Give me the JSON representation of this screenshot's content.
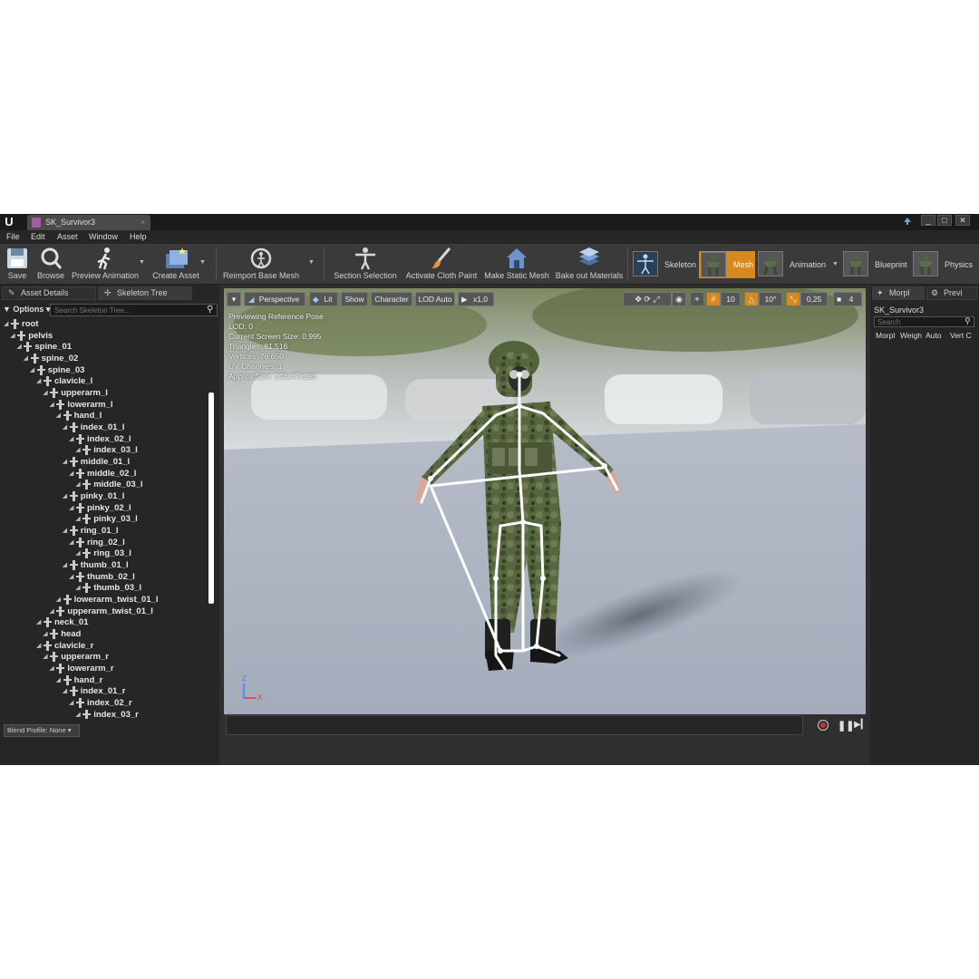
{
  "window": {
    "tab_title": "SK_Survivor3",
    "tab_close": "×",
    "logo": "U",
    "controls": [
      "_",
      "□",
      "✕"
    ]
  },
  "menu": [
    "File",
    "Edit",
    "Asset",
    "Window",
    "Help"
  ],
  "toolbar": {
    "save": "Save",
    "browse": "Browse",
    "preview_animation": "Preview Animation",
    "create_asset": "Create Asset",
    "reimport_base_mesh": "Reimport Base Mesh",
    "section_selection": "Section Selection",
    "activate_cloth_paint": "Activate Cloth Paint",
    "make_static_mesh": "Make Static Mesh",
    "bake_out_materials": "Bake out Materials",
    "modes": [
      "Skeleton",
      "Mesh",
      "Animation",
      "Blueprint",
      "Physics"
    ],
    "active_mode": "Mesh"
  },
  "left_panel": {
    "tabs": [
      "Asset Details",
      "Skeleton Tree"
    ],
    "options_label": "Options",
    "search_placeholder": "Search Skeleton Tree...",
    "blend_profile": "Blend Profile: None",
    "bones": [
      {
        "name": "root",
        "depth": 0
      },
      {
        "name": "pelvis",
        "depth": 1
      },
      {
        "name": "spine_01",
        "depth": 2
      },
      {
        "name": "spine_02",
        "depth": 3
      },
      {
        "name": "spine_03",
        "depth": 4
      },
      {
        "name": "clavicle_l",
        "depth": 5
      },
      {
        "name": "upperarm_l",
        "depth": 6
      },
      {
        "name": "lowerarm_l",
        "depth": 7
      },
      {
        "name": "hand_l",
        "depth": 8
      },
      {
        "name": "index_01_l",
        "depth": 9
      },
      {
        "name": "index_02_l",
        "depth": 10
      },
      {
        "name": "index_03_l",
        "depth": 11
      },
      {
        "name": "middle_01_l",
        "depth": 9
      },
      {
        "name": "middle_02_l",
        "depth": 10
      },
      {
        "name": "middle_03_l",
        "depth": 11
      },
      {
        "name": "pinky_01_l",
        "depth": 9
      },
      {
        "name": "pinky_02_l",
        "depth": 10
      },
      {
        "name": "pinky_03_l",
        "depth": 11
      },
      {
        "name": "ring_01_l",
        "depth": 9
      },
      {
        "name": "ring_02_l",
        "depth": 10
      },
      {
        "name": "ring_03_l",
        "depth": 11
      },
      {
        "name": "thumb_01_l",
        "depth": 9
      },
      {
        "name": "thumb_02_l",
        "depth": 10
      },
      {
        "name": "thumb_03_l",
        "depth": 11
      },
      {
        "name": "lowerarm_twist_01_l",
        "depth": 8
      },
      {
        "name": "upperarm_twist_01_l",
        "depth": 7
      },
      {
        "name": "neck_01",
        "depth": 5
      },
      {
        "name": "head",
        "depth": 6
      },
      {
        "name": "clavicle_r",
        "depth": 5
      },
      {
        "name": "upperarm_r",
        "depth": 6
      },
      {
        "name": "lowerarm_r",
        "depth": 7
      },
      {
        "name": "hand_r",
        "depth": 8
      },
      {
        "name": "index_01_r",
        "depth": 9
      },
      {
        "name": "index_02_r",
        "depth": 10
      },
      {
        "name": "index_03_r",
        "depth": 11
      }
    ]
  },
  "viewport": {
    "perspective": "Perspective",
    "lit": "Lit",
    "show": "Show",
    "character": "Character",
    "lod": "LOD Auto",
    "play_speed": "x1,0",
    "grid_snap": "10",
    "rot_snap": "10°",
    "scale_snap": "0,25",
    "camera_speed": "4",
    "info": [
      "Previewing Reference Pose",
      "LOD: 0",
      "Current Screen Size: 0,995",
      "Triangles: 81 516",
      "Vertices: 76 650",
      "UV Channels: 1",
      "Approx Size: 148x47x195"
    ],
    "axis_z": "Z",
    "axis_x": "X"
  },
  "right_panel": {
    "tabs": [
      "Morpl",
      "Previ"
    ],
    "title": "SK_Survivor3",
    "search_placeholder": "Search",
    "columns": [
      "Morpl",
      "Weigh",
      "Auto",
      "Vert C"
    ]
  },
  "colors": {
    "accent_orange": "#d7891d",
    "panel_bg": "#262626",
    "toolbar_bg": "#3a3a3a"
  }
}
